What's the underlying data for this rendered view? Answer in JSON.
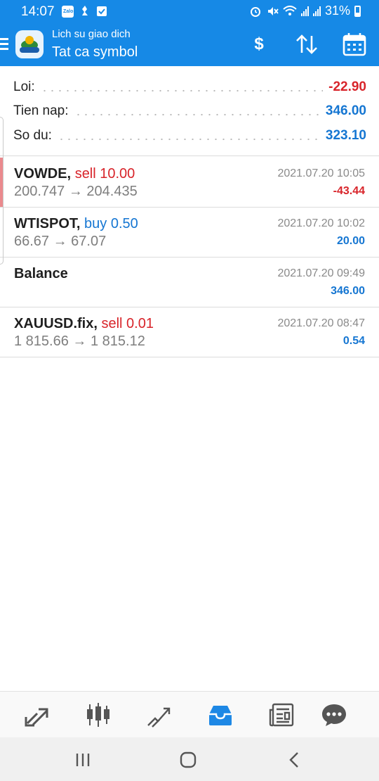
{
  "status_bar": {
    "time": "14:07",
    "battery": "31%",
    "zalo_label": "Zalo"
  },
  "app_bar": {
    "subtitle": "Lich su giao dich",
    "title": "Tat ca symbol",
    "exchange_icon": "$"
  },
  "summary": [
    {
      "label": "Loi:",
      "value": "-22.90"
    },
    {
      "label": "Tien nap:",
      "value": "346.00"
    },
    {
      "label": "So du:",
      "value": "323.10"
    }
  ],
  "deals": [
    {
      "symbol": "VOWDE,",
      "side": "sell 10.00",
      "prices": "200.747 → 204.435",
      "datetime": "2021.07.20 10:05",
      "profit": "-43.44"
    },
    {
      "symbol": "WTISPOT,",
      "side": "buy 0.50",
      "prices": "66.67 → 67.07",
      "datetime": "2021.07.20 10:02",
      "profit": "20.00"
    },
    {
      "symbol": "Balance",
      "side": "",
      "prices": "",
      "datetime": "2021.07.20 09:49",
      "profit": "346.00"
    },
    {
      "symbol": "XAUUSD.fix,",
      "side": "sell 0.01",
      "prices": "1 815.66 → 1 815.12",
      "datetime": "2021.07.20 08:47",
      "profit": "0.54"
    }
  ],
  "bottom_nav": [
    "quotes-icon",
    "chart-icon",
    "trade-icon",
    "history-icon",
    "news-icon",
    "messages-icon"
  ],
  "colors": {
    "accent": "#1689e6",
    "negative": "#d8242a",
    "positive": "#1576d2",
    "active_nav": "#1e88e5"
  }
}
